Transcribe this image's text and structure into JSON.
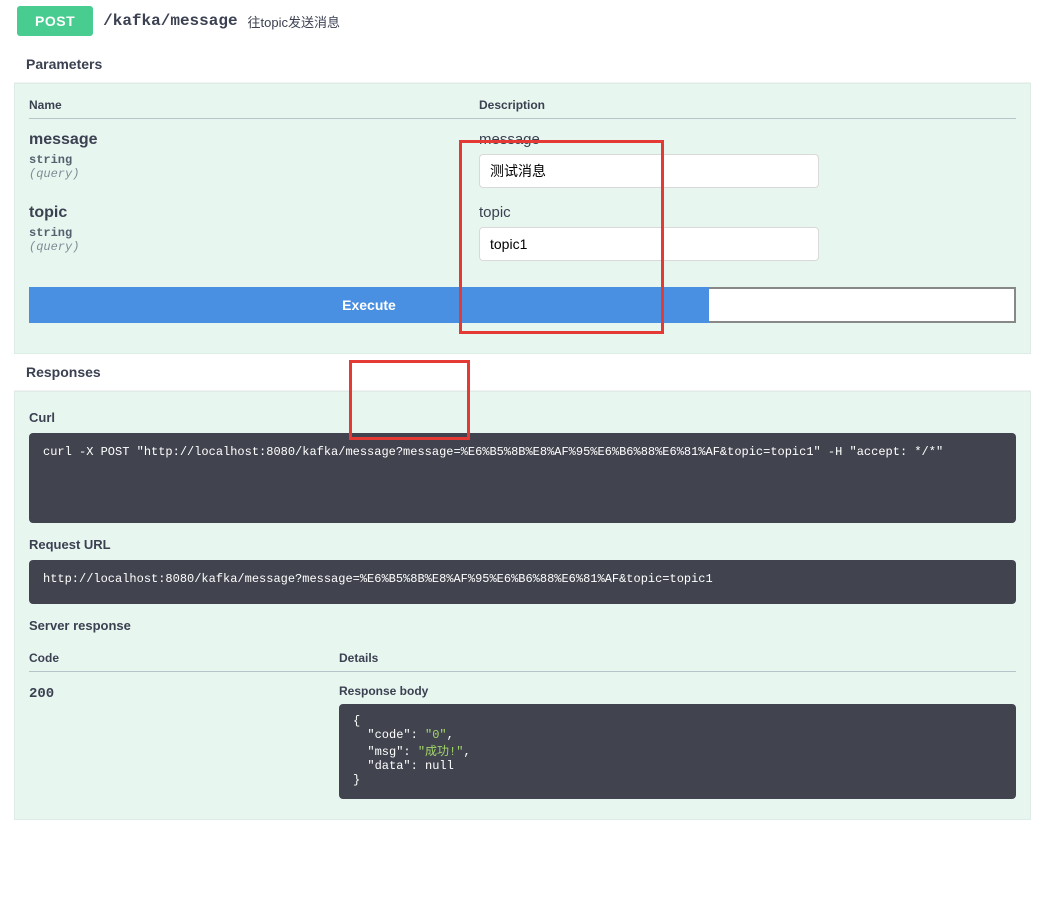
{
  "op": {
    "method": "POST",
    "path": "/kafka/message",
    "summary": "往topic发送消息"
  },
  "sections": {
    "parameters": "Parameters",
    "responses": "Responses"
  },
  "param_header": {
    "name": "Name",
    "description": "Description"
  },
  "params": [
    {
      "name": "message",
      "type": "string",
      "in": "(query)",
      "label": "message",
      "value": "测试消息"
    },
    {
      "name": "topic",
      "type": "string",
      "in": "(query)",
      "label": "topic",
      "value": "topic1"
    }
  ],
  "buttons": {
    "execute": "Execute"
  },
  "resp": {
    "curl_label": "Curl",
    "curl": "curl -X POST \"http://localhost:8080/kafka/message?message=%E6%B5%8B%E8%AF%95%E6%B6%88%E6%81%AF&topic=topic1\" -H \"accept: */*\"",
    "request_url_label": "Request URL",
    "request_url": "http://localhost:8080/kafka/message?message=%E6%B5%8B%E8%AF%95%E6%B6%88%E6%81%AF&topic=topic1",
    "server_response_label": "Server response",
    "code_header": "Code",
    "details_header": "Details",
    "status": "200",
    "response_body_label": "Response body",
    "body": {
      "code": "0",
      "msg": "成功!",
      "data": null
    }
  }
}
